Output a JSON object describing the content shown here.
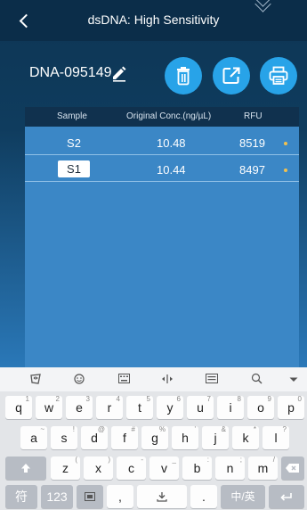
{
  "header": {
    "title": "dsDNA: High Sensitivity"
  },
  "sample": {
    "id": "DNA-095149"
  },
  "table": {
    "headers": [
      "Sample",
      "Original Conc.(ng/µL)",
      "RFU"
    ],
    "rows": [
      {
        "sample": "S2",
        "conc": "10.48",
        "rfu": "8519",
        "selected": false
      },
      {
        "sample": "S1",
        "conc": "10.44",
        "rfu": "8497",
        "selected": true
      }
    ]
  },
  "keyboard": {
    "row1": [
      {
        "k": "q",
        "s": "1"
      },
      {
        "k": "w",
        "s": "2"
      },
      {
        "k": "e",
        "s": "3"
      },
      {
        "k": "r",
        "s": "4"
      },
      {
        "k": "t",
        "s": "5"
      },
      {
        "k": "y",
        "s": "6"
      },
      {
        "k": "u",
        "s": "7"
      },
      {
        "k": "i",
        "s": "8"
      },
      {
        "k": "o",
        "s": "9"
      },
      {
        "k": "p",
        "s": "0"
      }
    ],
    "row2": [
      {
        "k": "a",
        "s": "~"
      },
      {
        "k": "s",
        "s": "!"
      },
      {
        "k": "d",
        "s": "@"
      },
      {
        "k": "f",
        "s": "#"
      },
      {
        "k": "g",
        "s": "%"
      },
      {
        "k": "h",
        "s": "'"
      },
      {
        "k": "j",
        "s": "&"
      },
      {
        "k": "k",
        "s": "*"
      },
      {
        "k": "l",
        "s": "?"
      }
    ],
    "row3": [
      {
        "k": "z",
        "s": "("
      },
      {
        "k": "x",
        "s": ")"
      },
      {
        "k": "c",
        "s": "-"
      },
      {
        "k": "v",
        "s": "_"
      },
      {
        "k": "b",
        "s": ":"
      },
      {
        "k": "n",
        "s": ";"
      },
      {
        "k": "m",
        "s": "/"
      }
    ],
    "fu_label": "符",
    "num_label": "123",
    "comma_label": ",",
    "period_label": ".",
    "lang_label": "中/英"
  }
}
